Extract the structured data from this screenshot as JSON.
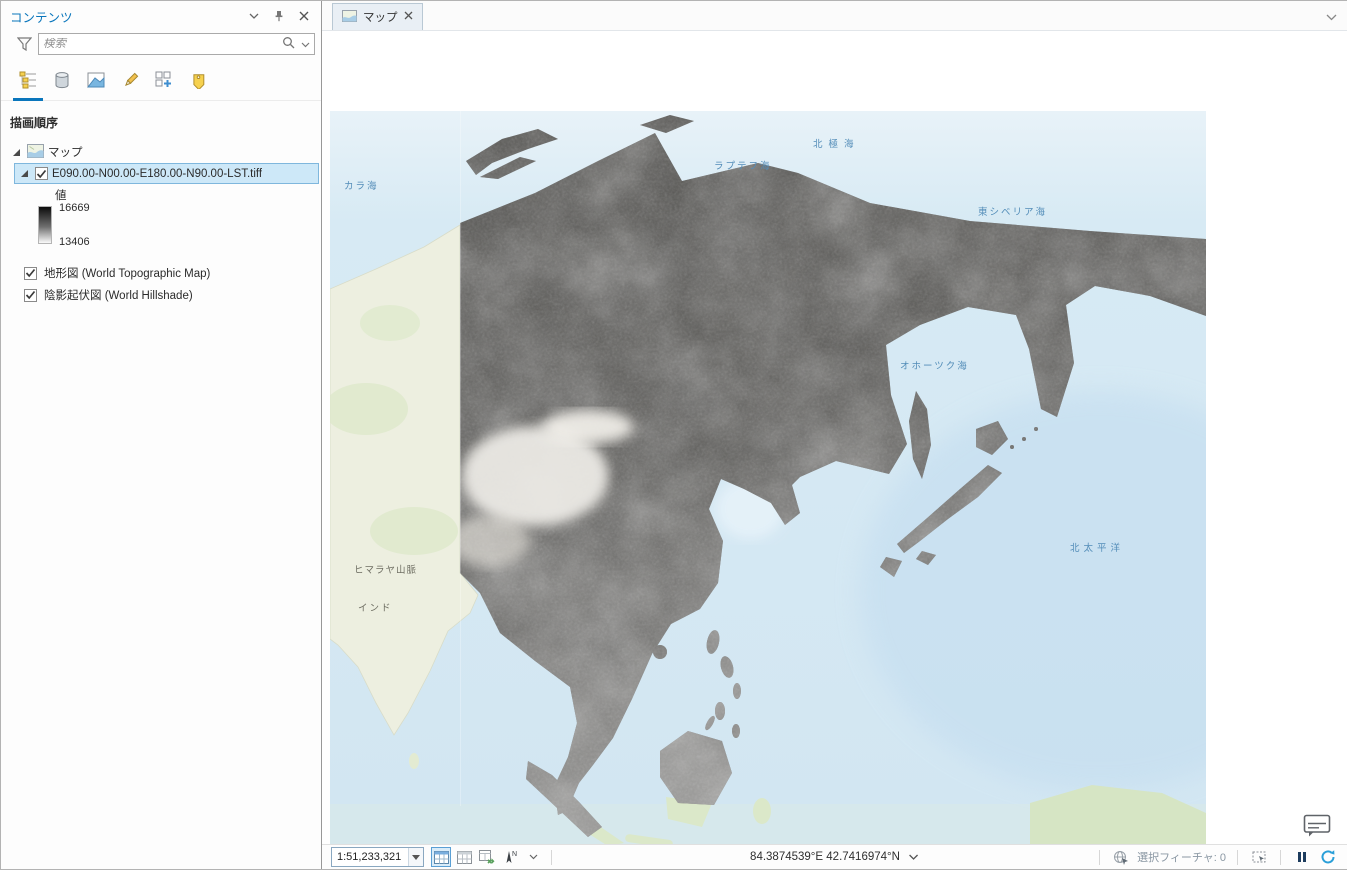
{
  "colors": {
    "pane_title_blue": "#0a76bc",
    "selection_highlight": "#cde8f8",
    "active_underline": "#0a76bc",
    "refresh_icon_blue": "#2a9fd8",
    "pause_icon_navy": "#1d3c5e",
    "sea_label_blue": "#528cb8"
  },
  "contents_pane": {
    "title": "コンテンツ",
    "search": {
      "placeholder": "検索"
    },
    "toolbar_icons": [
      "list-by-drawing-order",
      "list-by-data-source",
      "list-by-selection",
      "list-by-editing",
      "list-by-snapping",
      "list-by-labeling"
    ],
    "section_header": "描画順序",
    "tree": {
      "root_label": "マップ",
      "raster_layer": {
        "name": "E090.00-N00.00-E180.00-N90.00-LST.tiff",
        "legend_label": "値",
        "max_value": "16669",
        "min_value": "13406"
      },
      "basemap_layers": [
        {
          "name": "地形図 (World Topographic Map)"
        },
        {
          "name": "陰影起伏図 (World Hillshade)"
        }
      ]
    }
  },
  "view_tabs": {
    "map_tab": "マップ"
  },
  "map_view": {
    "sea_labels": [
      {
        "text": "北極海"
      },
      {
        "text": "カラ海"
      },
      {
        "text": "ラプテフ海"
      },
      {
        "text": "東シベリア海"
      },
      {
        "text": "オホーツク海"
      },
      {
        "text": "北太平洋"
      }
    ],
    "land_labels": [
      {
        "text": "ヒマラヤ山脈"
      },
      {
        "text": "インド"
      }
    ]
  },
  "status_bar": {
    "scale": "1:51,233,321",
    "coordinates": "84.3874539°E 42.7416974°N",
    "selection_status": "選択フィーチャ: 0",
    "north_label": "N"
  }
}
